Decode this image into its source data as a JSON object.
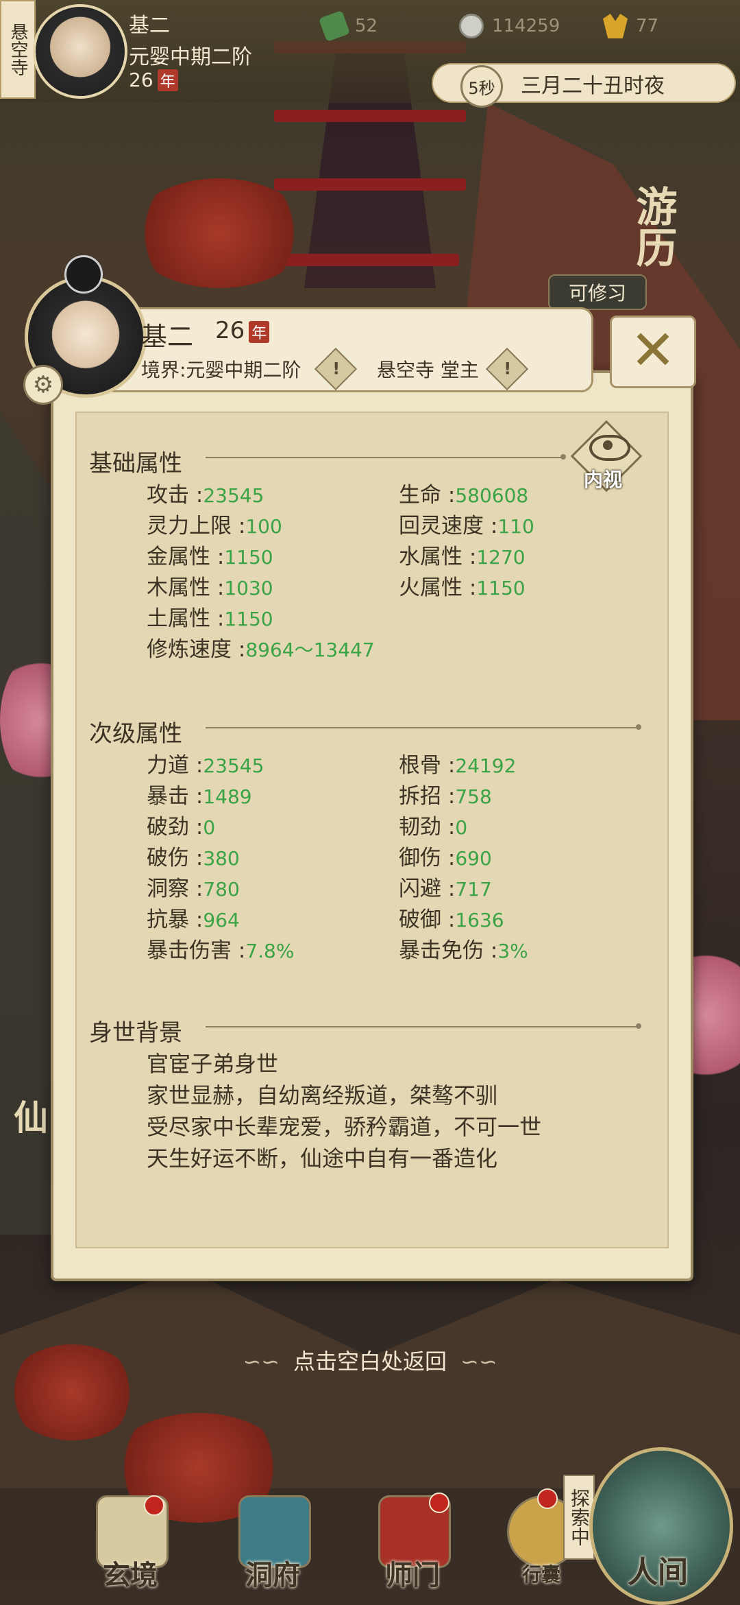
{
  "hud": {
    "sect_tag": "悬空寺",
    "name": "基二",
    "realm": "元婴中期二阶",
    "age": "26",
    "year_mark": "年",
    "resources": [
      {
        "icon": "jade-icon",
        "value": "52"
      },
      {
        "icon": "coin-icon",
        "value": "114259"
      },
      {
        "icon": "strength-icon",
        "value": "77"
      }
    ],
    "timer": "5秒",
    "date_text": "三月二十丑时夜"
  },
  "scenery": {
    "travel_label": "游历",
    "cultivable_chip": "可修习",
    "immortal_label": "仙"
  },
  "panel": {
    "name": "基二",
    "age": "26",
    "year_mark": "年",
    "realm": "境界:元婴中期二阶",
    "sect": "悬空寺 堂主",
    "warn_glyph": "!",
    "close_glyph": "✕",
    "inner_view_label": "内视",
    "basic": {
      "title": "基础属性",
      "left": [
        {
          "label": "攻击 :",
          "value": "23545"
        },
        {
          "label": "灵力上限 :",
          "value": "100"
        },
        {
          "label": "金属性 :",
          "value": "1150"
        },
        {
          "label": "木属性 :",
          "value": "1030"
        },
        {
          "label": "土属性 :",
          "value": "1150"
        },
        {
          "label": "修炼速度 :",
          "value": "8964～13447"
        }
      ],
      "right": [
        {
          "label": "生命 :",
          "value": "580608"
        },
        {
          "label": "回灵速度 :",
          "value": "110"
        },
        {
          "label": "水属性 :",
          "value": "1270"
        },
        {
          "label": "火属性 :",
          "value": "1150"
        }
      ]
    },
    "secondary": {
      "title": "次级属性",
      "left": [
        {
          "label": "力道 :",
          "value": "23545"
        },
        {
          "label": "暴击 :",
          "value": "1489"
        },
        {
          "label": "破劲 :",
          "value": "0"
        },
        {
          "label": "破伤 :",
          "value": "380"
        },
        {
          "label": "洞察 :",
          "value": "780"
        },
        {
          "label": "抗暴 :",
          "value": "964"
        },
        {
          "label": "暴击伤害 :",
          "value": "7.8%"
        }
      ],
      "right": [
        {
          "label": "根骨 :",
          "value": "24192"
        },
        {
          "label": "拆招 :",
          "value": "758"
        },
        {
          "label": "韧劲 :",
          "value": "0"
        },
        {
          "label": "御伤 :",
          "value": "690"
        },
        {
          "label": "闪避 :",
          "value": "717"
        },
        {
          "label": "破御 :",
          "value": "1636"
        },
        {
          "label": "暴击免伤 :",
          "value": "3%"
        }
      ]
    },
    "background": {
      "title": "身世背景",
      "lines": [
        "官宦子弟身世",
        "家世显赫，自幼离经叛道，桀骜不驯",
        "受尽家中长辈宠爱，骄矜霸道，不可一世",
        "天生好运不断，仙途中自有一番造化"
      ]
    }
  },
  "tip": "点击空白处返回",
  "nav": {
    "items": [
      "玄境",
      "洞府",
      "师门",
      "行囊"
    ],
    "explore_tag": "探索中",
    "human_world": "人间"
  },
  "colors": {
    "value_green": "#3aa346",
    "panel_bg": "#efe5c7",
    "badge_red": "#b03a2a"
  }
}
